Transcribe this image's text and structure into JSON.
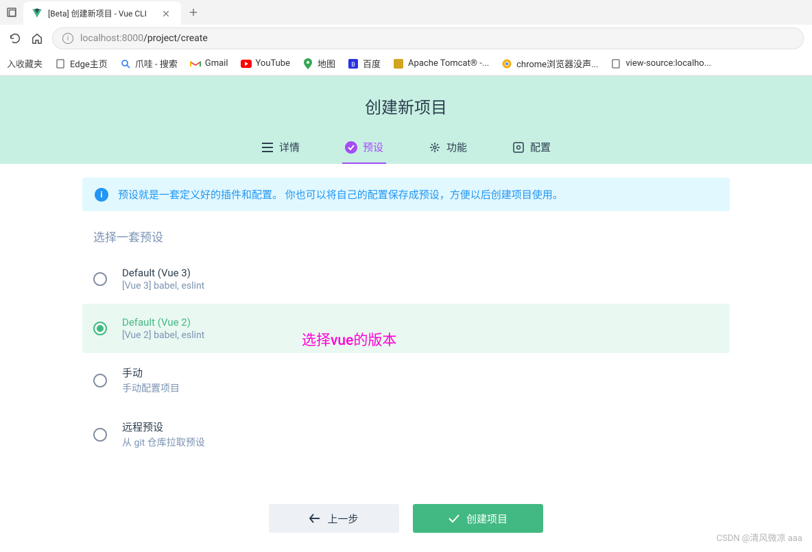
{
  "browser": {
    "tab_title": "[Beta] 创建新项目 - Vue CLI",
    "url_host": "localhost:8000",
    "url_path": "/project/create",
    "favorites_label": "入收藏夹",
    "bookmarks": [
      {
        "label": "Edge主页",
        "icon": "page"
      },
      {
        "label": "爪哇 - 搜索",
        "icon": "search"
      },
      {
        "label": "Gmail",
        "icon": "gmail"
      },
      {
        "label": "YouTube",
        "icon": "youtube"
      },
      {
        "label": "地图",
        "icon": "maps"
      },
      {
        "label": "百度",
        "icon": "baidu"
      },
      {
        "label": "Apache Tomcat® -...",
        "icon": "tomcat"
      },
      {
        "label": "chrome浏览器没声...",
        "icon": "chrome"
      },
      {
        "label": "view-source:localho...",
        "icon": "page"
      }
    ]
  },
  "page": {
    "title": "创建新项目",
    "tabs": [
      {
        "label": "详情",
        "icon": "list"
      },
      {
        "label": "预设",
        "icon": "check"
      },
      {
        "label": "功能",
        "icon": "tool"
      },
      {
        "label": "配置",
        "icon": "gear"
      }
    ],
    "active_tab_index": 1,
    "info_text": "预设就是一套定义好的插件和配置。 你也可以将自己的配置保存成预设，方便以后创建项目使用。",
    "section_title": "选择一套预设",
    "presets": [
      {
        "title": "Default (Vue 3)",
        "desc": "[Vue 3] babel, eslint"
      },
      {
        "title": "Default (Vue 2)",
        "desc": "[Vue 2] babel, eslint"
      },
      {
        "title": "手动",
        "desc": "手动配置项目"
      },
      {
        "title": "远程预设",
        "desc": "从 git 仓库拉取预设"
      }
    ],
    "selected_preset_index": 1,
    "annotation": "选择vue的版本",
    "btn_prev": "上一步",
    "btn_create": "创建项目",
    "watermark": "CSDN @清风微凉 aaa"
  }
}
